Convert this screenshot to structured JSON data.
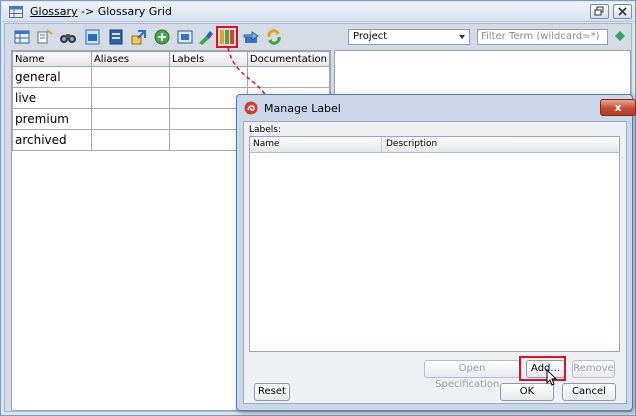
{
  "window": {
    "breadcrumb_link": "Glossary",
    "breadcrumb_rest": "-> Glossary Grid"
  },
  "toolbar": {
    "icons": [
      "new-table-icon",
      "edit-term-icon",
      "binoculars-icon",
      "open-spec-icon",
      "document-icon",
      "extract-icon",
      "add-icon",
      "fit-icon",
      "highlight-icon",
      "label-icon",
      "import-icon",
      "refresh-icon"
    ],
    "highlight_color": "#e0102a",
    "scope_select": "Project",
    "filter_placeholder": "Filter Term (wildcard=*)"
  },
  "grid": {
    "columns": [
      "Name",
      "Aliases",
      "Labels",
      "Documentation"
    ],
    "rows": [
      {
        "name": "general"
      },
      {
        "name": "live"
      },
      {
        "name": "premium"
      },
      {
        "name": "archived"
      }
    ]
  },
  "dialog": {
    "title": "Manage Label",
    "close_label": "x",
    "labels_caption": "Labels:",
    "columns": [
      "Name",
      "Description"
    ],
    "buttons": {
      "open_spec": "Open Specification...",
      "add": "Add...",
      "remove": "Remove",
      "reset": "Reset",
      "ok": "OK",
      "cancel": "Cancel"
    }
  }
}
